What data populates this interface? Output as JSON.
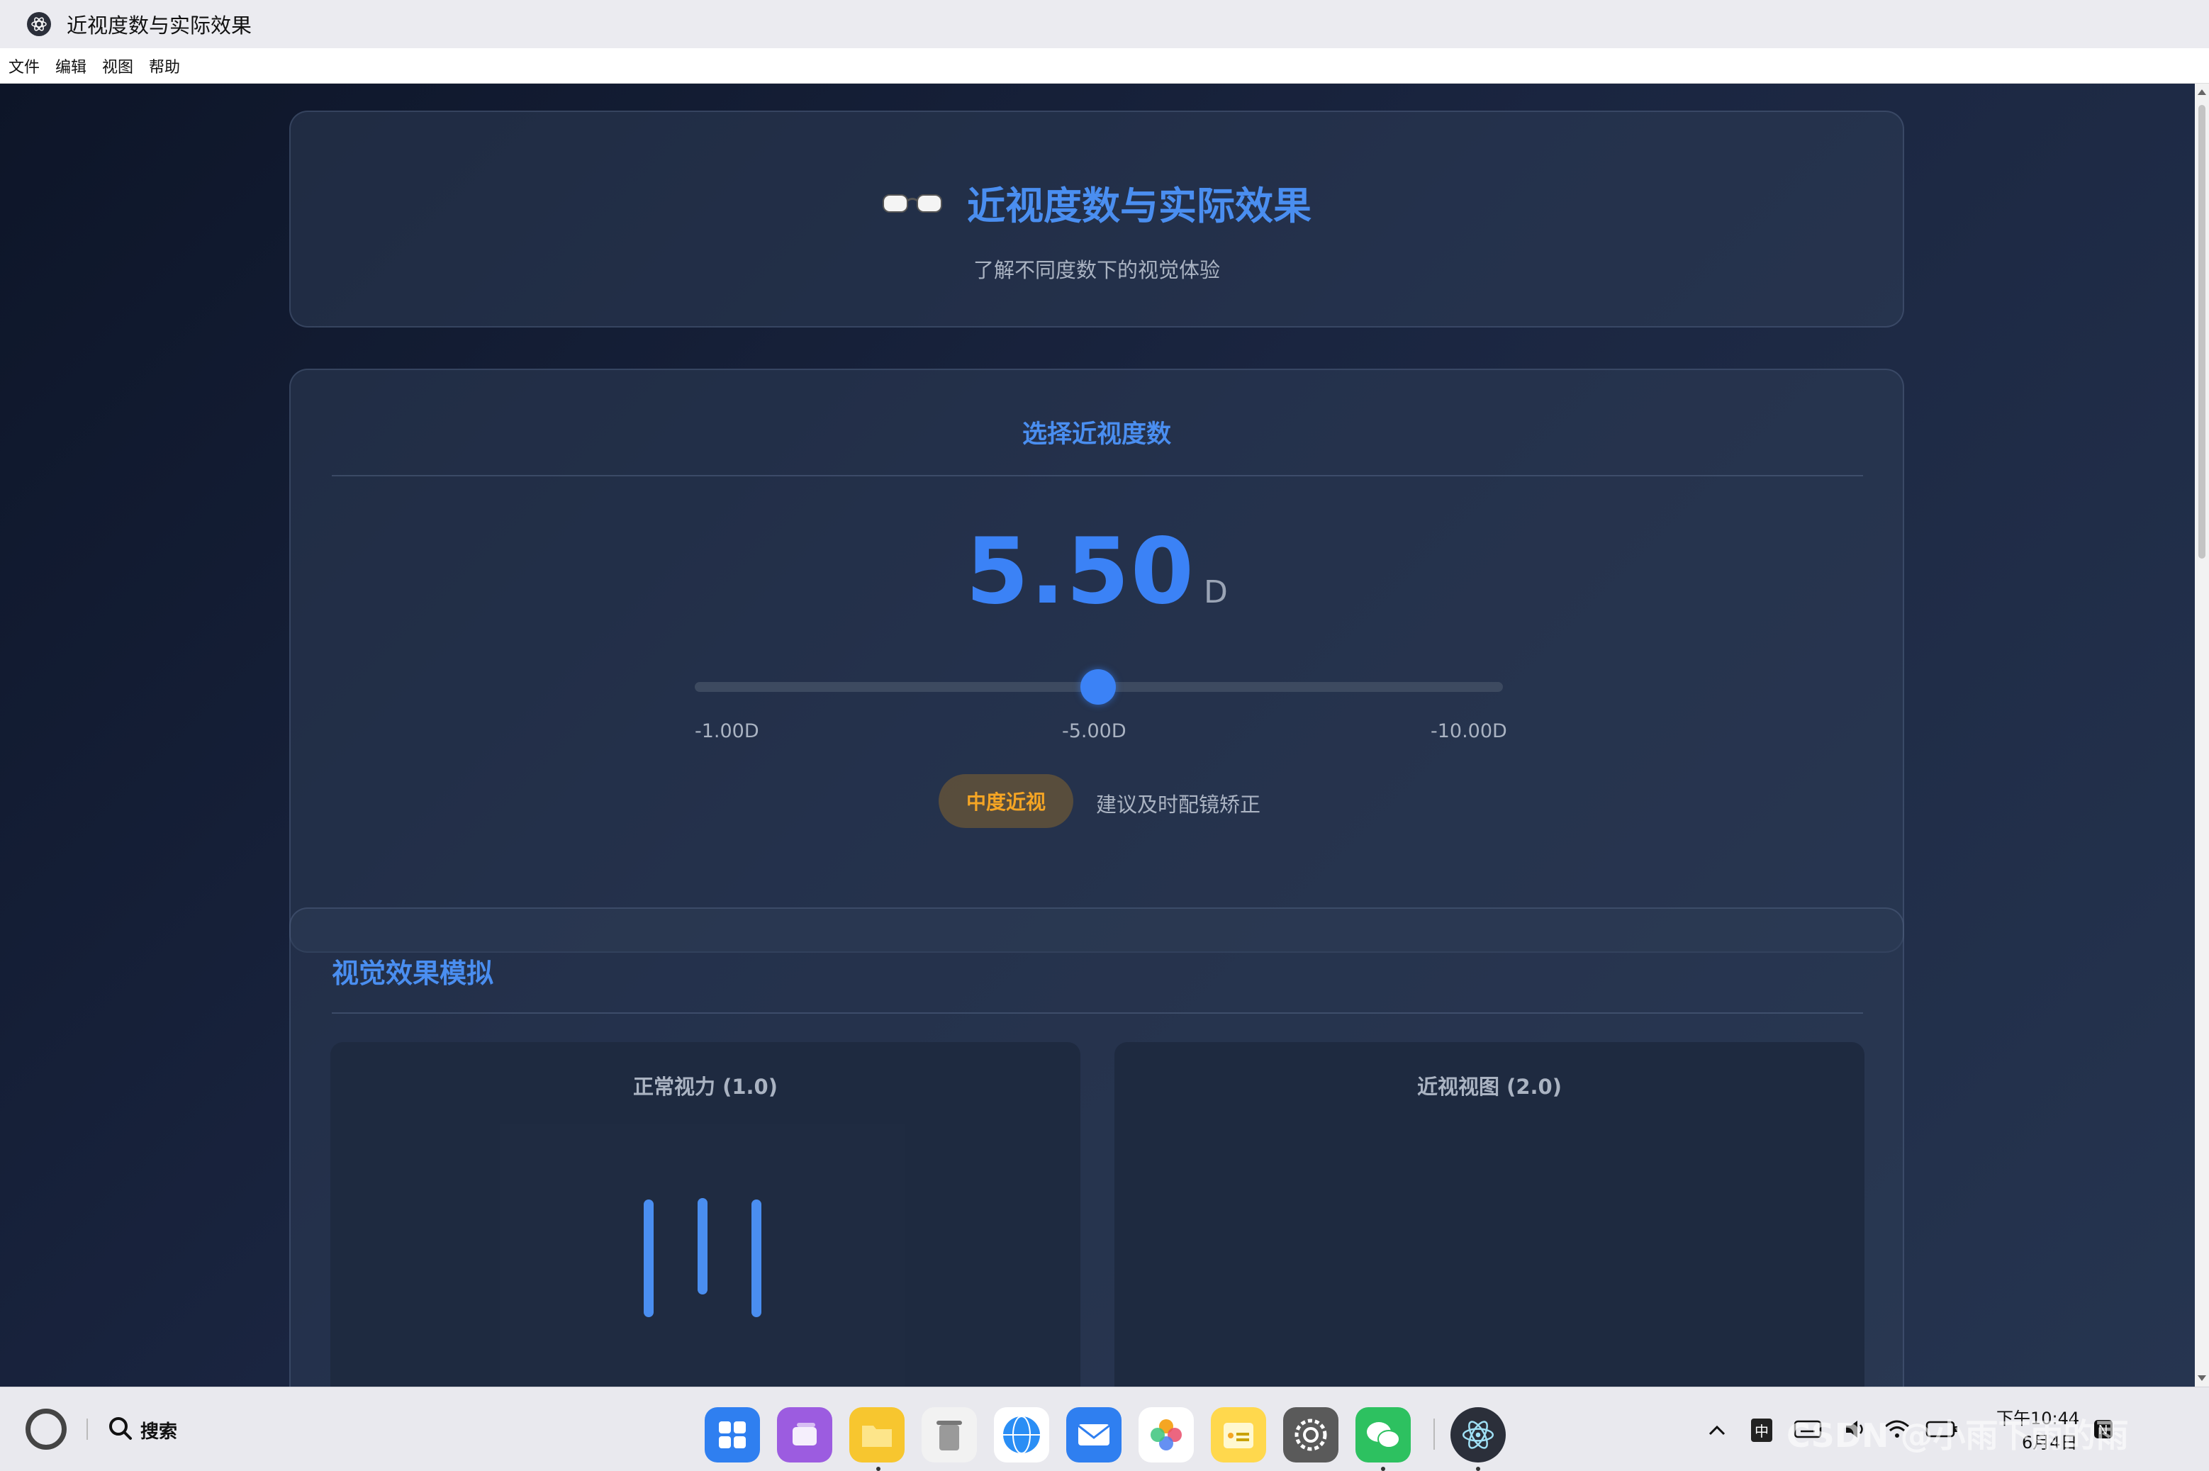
{
  "window": {
    "title": "近视度数与实际效果"
  },
  "menu": {
    "items": [
      "文件",
      "编辑",
      "视图",
      "帮助"
    ]
  },
  "header": {
    "icon": "glasses-icon",
    "title": "近视度数与实际效果",
    "subtitle": "了解不同度数下的视觉体验"
  },
  "selector": {
    "title": "选择近视度数",
    "value": "5.50",
    "unit": "D",
    "slider": {
      "min_label": "-1.00D",
      "mid_label": "-5.00D",
      "max_label": "-10.00D",
      "value": 5.5
    },
    "level_badge": "中度近视",
    "advice": "建议及时配镜矫正",
    "accent_color": "#3b82f6",
    "badge_color": "#f5a524"
  },
  "simulation": {
    "title": "视觉效果模拟",
    "panels": [
      {
        "title": "正常视力 (1.0)"
      },
      {
        "title": "近视视图 (2.0)"
      }
    ]
  },
  "taskbar": {
    "search_label": "搜索",
    "dock_icons": [
      "launcher-icon",
      "multitask-icon",
      "files-icon",
      "trash-icon",
      "browser-icon",
      "mail-icon",
      "photos-icon",
      "notes-icon",
      "settings-icon",
      "wechat-icon",
      "electron-app-icon"
    ],
    "tray": {
      "ime": "中",
      "time": "下午10:44",
      "date": "6月4日"
    },
    "watermark": "CSDN @小雨下雨的雨"
  }
}
